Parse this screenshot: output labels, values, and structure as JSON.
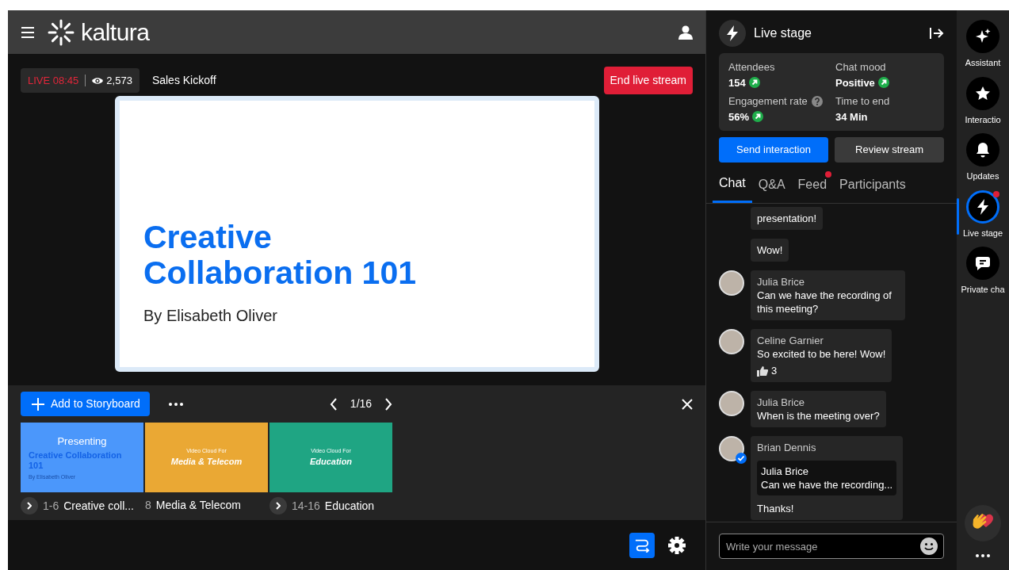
{
  "header": {
    "logo": "kaltura"
  },
  "stream_info": {
    "live": "LIVE 08:45",
    "viewers": "2,573",
    "title": "Sales Kickoff",
    "end_button": "End live stream"
  },
  "slide": {
    "title": "Creative Collaboration 101",
    "subtitle": "By Elisabeth Oliver"
  },
  "storyboard": {
    "add_button": "Add to Storyboard",
    "page": "1/16",
    "chapters": [
      {
        "range": "1-6",
        "title": "Creative coll...",
        "expandable": true,
        "color": "#4b97fb",
        "overlay": "Presenting",
        "thumb_title": "Creative Collaboration 101",
        "thumb_byline": "By Elisabeth Oliver"
      },
      {
        "range": "8",
        "title": "Media & Telecom",
        "expandable": false,
        "color": "#eaa834",
        "thumb_caption": "Video Cloud For",
        "thumb_title": "Media & Telecom"
      },
      {
        "range": "14-16",
        "title": "Education",
        "expandable": true,
        "color": "#1fa583",
        "thumb_caption": "Video Cloud For",
        "thumb_title": "Education"
      }
    ]
  },
  "bottom_tools": [
    {
      "kind": "route",
      "selected": true
    },
    {
      "kind": "settings",
      "selected": false
    }
  ],
  "panel": {
    "title": "Live stage",
    "stats": [
      {
        "label": "Attendees",
        "value": "154",
        "rising": true,
        "help": false
      },
      {
        "label": "Chat mood",
        "value": "Positive",
        "rising": true,
        "help": false
      },
      {
        "label": "Engagement rate",
        "value": "56%",
        "rising": true,
        "help": true
      },
      {
        "label": "Time to end",
        "value": "34 Min",
        "rising": false,
        "help": false
      }
    ],
    "buttons": [
      {
        "label": "Send interaction",
        "kind": "primary"
      },
      {
        "label": "Review stream",
        "kind": "secondary"
      }
    ],
    "tabs": [
      {
        "label": "Chat",
        "selected": true,
        "unread": false
      },
      {
        "label": "Q&A",
        "selected": false,
        "unread": false
      },
      {
        "label": "Feed",
        "selected": false,
        "unread": true
      },
      {
        "label": "Participants",
        "selected": false,
        "unread": false
      }
    ],
    "messages": [
      {
        "text": "presentation!",
        "verified": false
      },
      {
        "text": "Wow!",
        "verified": false
      },
      {
        "author": "Julia Brice",
        "text": "Can we have the recording of this meeting?",
        "verified": false
      },
      {
        "author": "Celine Garnier",
        "text": "So excited to be here! Wow!",
        "verified": false,
        "likes": "3"
      },
      {
        "author": "Julia Brice",
        "text": "When is the meeting over?",
        "verified": false
      },
      {
        "author": "Brian Dennis",
        "text": "Thanks!",
        "verified": true,
        "quote": {
          "author": "Julia Brice",
          "text": "Can we have the recording..."
        }
      }
    ],
    "composer": {
      "placeholder": "Write your message"
    }
  },
  "rail": [
    {
      "label": "Assistant",
      "kind": "sparkles",
      "selected": false,
      "unread": false
    },
    {
      "label": "Interactio",
      "kind": "star",
      "selected": false,
      "unread": false
    },
    {
      "label": "Updates",
      "kind": "bell",
      "selected": false,
      "unread": false
    },
    {
      "label": "Live stage",
      "kind": "bolt",
      "selected": true,
      "unread": true
    },
    {
      "label": "Private cha",
      "kind": "chat",
      "selected": false,
      "unread": false
    }
  ]
}
